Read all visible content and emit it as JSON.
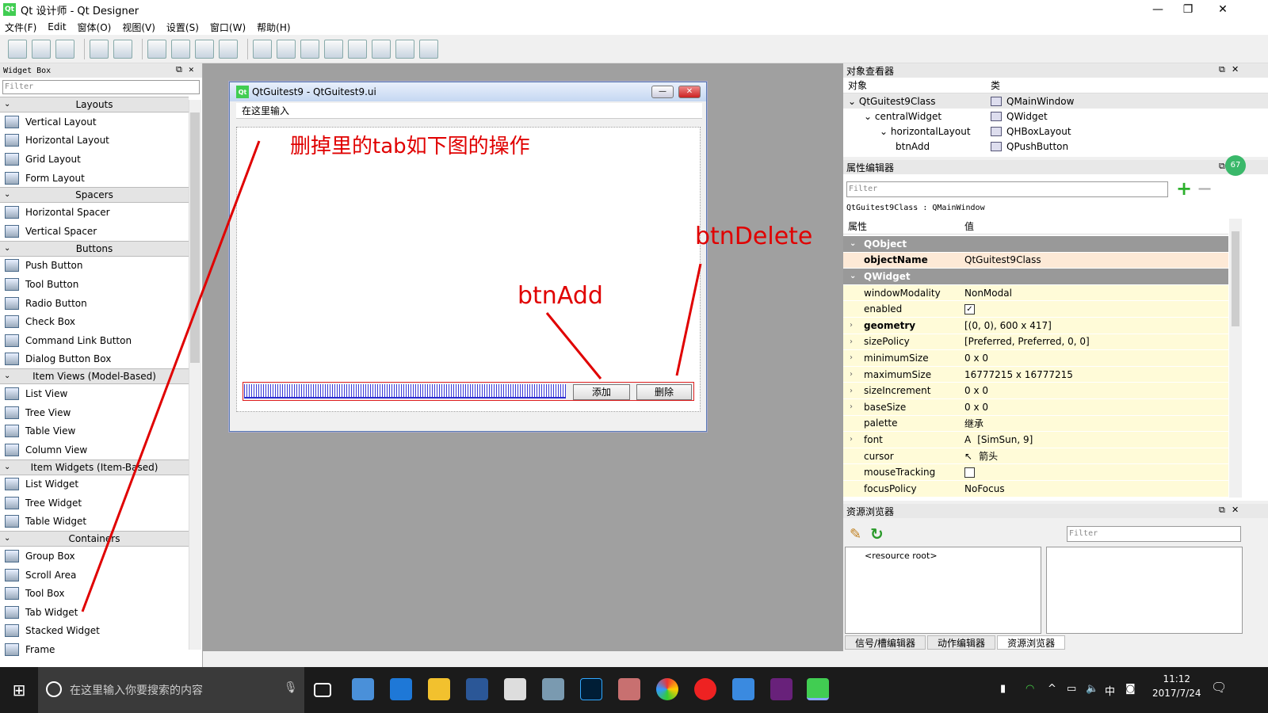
{
  "window": {
    "title": "Qt 设计师 - Qt Designer",
    "icon_text": "Qt",
    "minimize": "—",
    "restore": "❐",
    "close": "✕"
  },
  "menu": [
    "文件(F)",
    "Edit",
    "窗体(O)",
    "视图(V)",
    "设置(S)",
    "窗口(W)",
    "帮助(H)"
  ],
  "widget_box": {
    "title": "Widget Box",
    "filter_placeholder": "Filter",
    "categories": [
      {
        "name": "Layouts",
        "items": [
          "Vertical Layout",
          "Horizontal Layout",
          "Grid Layout",
          "Form Layout"
        ]
      },
      {
        "name": "Spacers",
        "items": [
          "Horizontal Spacer",
          "Vertical Spacer"
        ]
      },
      {
        "name": "Buttons",
        "items": [
          "Push Button",
          "Tool Button",
          "Radio Button",
          "Check Box",
          "Command Link Button",
          "Dialog Button Box"
        ]
      },
      {
        "name": "Item Views (Model-Based)",
        "items": [
          "List View",
          "Tree View",
          "Table View",
          "Column View"
        ]
      },
      {
        "name": "Item Widgets (Item-Based)",
        "items": [
          "List Widget",
          "Tree Widget",
          "Table Widget"
        ]
      },
      {
        "name": "Containers",
        "items": [
          "Group Box",
          "Scroll Area",
          "Tool Box",
          "Tab Widget",
          "Stacked Widget",
          "Frame"
        ]
      }
    ]
  },
  "form": {
    "title": "QtGuitest9 - QtGuitest9.ui",
    "icon_text": "Qt",
    "menu_placeholder": "在这里输入",
    "btn_add": "添加",
    "btn_delete": "删除",
    "minimize": "—",
    "close": "✕"
  },
  "annotations": {
    "instruction": "删掉里的tab如下图的操作",
    "btnAdd": "btnAdd",
    "btnDelete": "btnDelete",
    "color": "#e00000"
  },
  "object_inspector": {
    "title": "对象查看器",
    "col_object": "对象",
    "col_class": "类",
    "rows": [
      {
        "object": "QtGuitest9Class",
        "class": "QMainWindow",
        "indent": 0
      },
      {
        "object": "centralWidget",
        "class": "QWidget",
        "indent": 1
      },
      {
        "object": "horizontalLayout",
        "class": "QHBoxLayout",
        "indent": 2
      },
      {
        "object": "btnAdd",
        "class": "QPushButton",
        "indent": 3
      }
    ]
  },
  "property_editor": {
    "title": "属性编辑器",
    "filter_placeholder": "Filter",
    "class_line": "QtGuitest9Class : QMainWindow",
    "col_property": "属性",
    "col_value": "值",
    "rows": [
      {
        "name": "QObject",
        "value": "",
        "type": "section"
      },
      {
        "name": "objectName",
        "value": "QtGuitest9Class",
        "type": "orange"
      },
      {
        "name": "QWidget",
        "value": "",
        "type": "section"
      },
      {
        "name": "windowModality",
        "value": "NonModal",
        "type": "yellow"
      },
      {
        "name": "enabled",
        "value": "",
        "type": "check-on"
      },
      {
        "name": "geometry",
        "value": "[(0, 0), 600 x 417]",
        "type": "yellow-exp-bold"
      },
      {
        "name": "sizePolicy",
        "value": "[Preferred, Preferred, 0, 0]",
        "type": "yellow-exp"
      },
      {
        "name": "minimumSize",
        "value": "0 x 0",
        "type": "yellow-exp"
      },
      {
        "name": "maximumSize",
        "value": "16777215 x 16777215",
        "type": "yellow-exp"
      },
      {
        "name": "sizeIncrement",
        "value": "0 x 0",
        "type": "yellow-exp"
      },
      {
        "name": "baseSize",
        "value": "0 x 0",
        "type": "yellow-exp"
      },
      {
        "name": "palette",
        "value": "继承",
        "type": "yellow"
      },
      {
        "name": "font",
        "value": "[SimSun, 9]",
        "type": "yellow-exp-font"
      },
      {
        "name": "cursor",
        "value": "箭头",
        "type": "yellow-cursor"
      },
      {
        "name": "mouseTracking",
        "value": "",
        "type": "check-off"
      },
      {
        "name": "focusPolicy",
        "value": "NoFocus",
        "type": "yellow"
      }
    ]
  },
  "resource_browser": {
    "title": "资源浏览器",
    "filter_placeholder": "Filter",
    "root": "<resource root>",
    "tabs": [
      "信号/槽编辑器",
      "动作编辑器",
      "资源浏览器"
    ]
  },
  "taskbar": {
    "search_placeholder": "在这里输入你要搜索的内容",
    "time": "11:12",
    "date": "2017/7/24",
    "ime": "中",
    "badge": "67"
  }
}
